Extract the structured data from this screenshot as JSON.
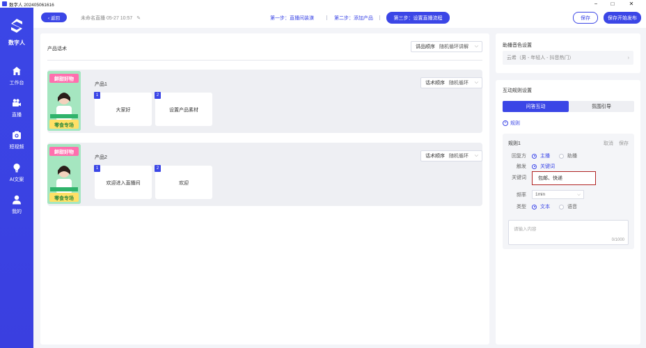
{
  "window": {
    "title": "数字人 202405061616",
    "minimize": "−",
    "maximize": "□",
    "close": "✕"
  },
  "sidebar": {
    "logo_text": "数字人",
    "items": [
      {
        "label": "工作台",
        "icon": "home-icon"
      },
      {
        "label": "直播",
        "icon": "video-camera-icon"
      },
      {
        "label": "短视频",
        "icon": "camera-icon"
      },
      {
        "label": "AI文案",
        "icon": "bulb-icon"
      },
      {
        "label": "我的",
        "icon": "user-icon"
      }
    ]
  },
  "topbar": {
    "back_label": "‹ 返回",
    "live_name": "未命名直播 05-27 10:57",
    "steps": [
      "第一步：直播间装潢",
      "第二步：添加产品",
      "第三步：设置直播流程"
    ],
    "save_label": "保存",
    "publish_label": "保存开始发布"
  },
  "main": {
    "title": "产品话术",
    "order_label": "讲品顺序",
    "order_value": "随机循环讲解",
    "products": [
      {
        "name": "产品1",
        "order_label": "话术顺序",
        "order_value": "随机循环",
        "scripts": [
          {
            "num": "1",
            "text": "大家好"
          },
          {
            "num": "2",
            "text": "设置产品素材"
          }
        ],
        "img_banner": "鲜甜好物",
        "img_tag": "零食专场"
      },
      {
        "name": "产品2",
        "order_label": "话术顺序",
        "order_value": "随机循环",
        "scripts": [
          {
            "num": "1",
            "text": "欢迎进入直播间"
          },
          {
            "num": "2",
            "text": "欢迎"
          }
        ],
        "img_banner": "鲜甜好物",
        "img_tag": "零食专场"
      }
    ]
  },
  "voice_panel": {
    "title": "助播音色设置",
    "value": "云希（男 - 年轻人 - 抖音热门）"
  },
  "interaction_panel": {
    "title": "互动规则设置",
    "tabs": [
      "问答互动",
      "氛围引导"
    ],
    "add_rule_label": "规则",
    "rule": {
      "name": "规则1",
      "cancel_label": "取消",
      "save_label": "保存",
      "responder_label": "回复方",
      "responder_options": [
        "主播",
        "助播"
      ],
      "trigger_label": "触发",
      "trigger_option": "关键词",
      "keyword_label": "关键词",
      "keyword_value": "包邮、快递",
      "frequency_label": "频率",
      "frequency_value": "1min",
      "type_label": "类型",
      "type_options": [
        "文本",
        "语音"
      ],
      "reply_placeholder": "请输入内容",
      "reply_count": "0/1000"
    }
  },
  "colors": {
    "accent": "#3b46e6",
    "keyword_border": "#b02222"
  }
}
